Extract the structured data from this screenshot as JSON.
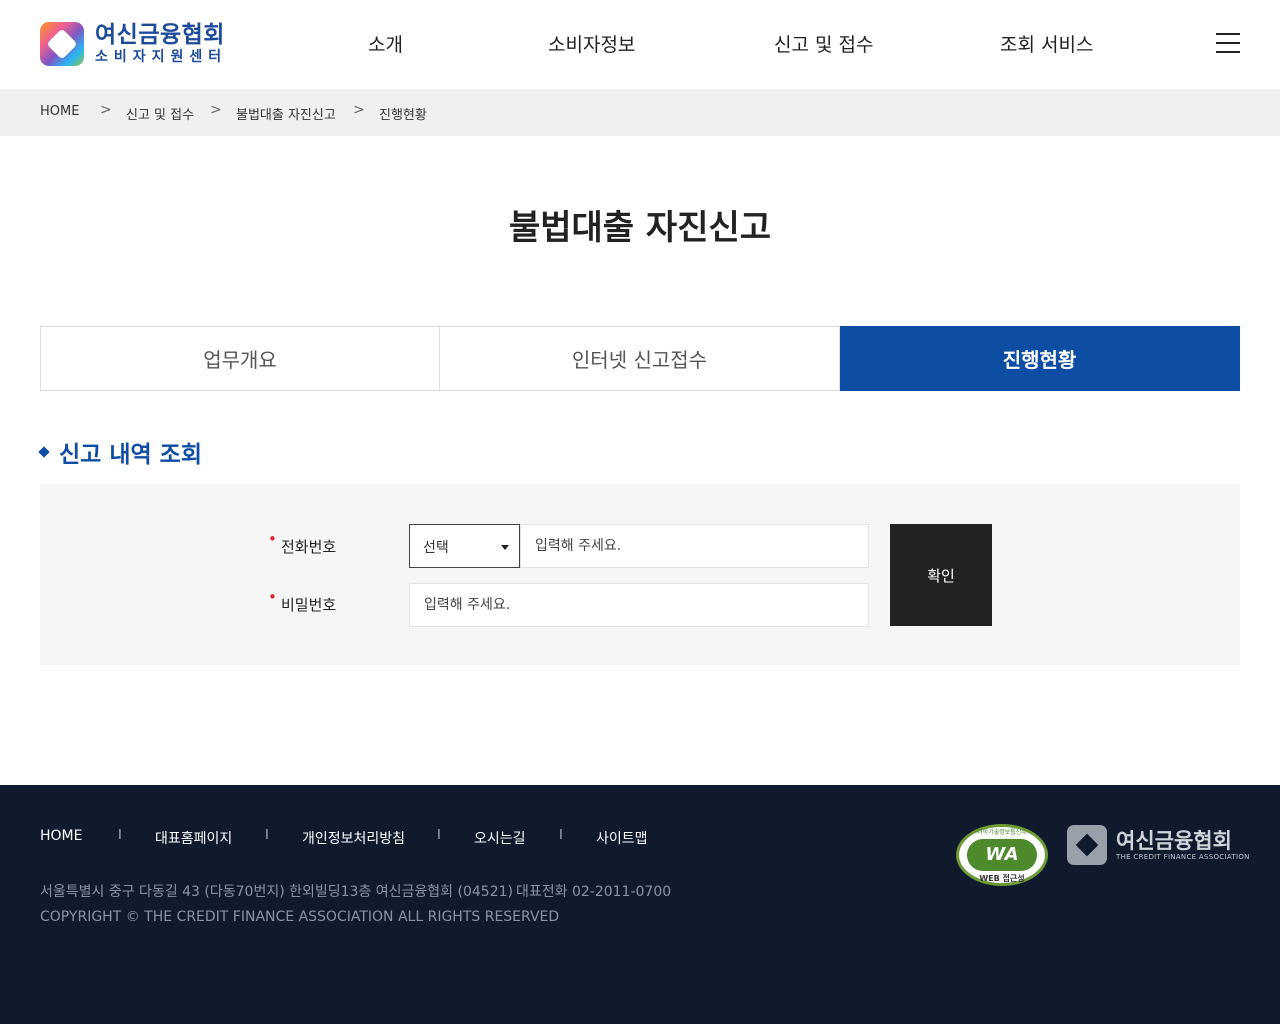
{
  "header": {
    "logo_main": "여신금융협회",
    "logo_sub": "소비자지원센터",
    "nav": [
      "소개",
      "소비자정보",
      "신고 및 접수",
      "조회 서비스"
    ]
  },
  "breadcrumb": [
    "HOME",
    "신고 및 접수",
    "불법대출 자진신고",
    "진행현황"
  ],
  "breadcrumb_sep": ">",
  "page_title": "불법대출 자진신고",
  "tabs": [
    {
      "label": "업무개요",
      "active": false
    },
    {
      "label": "인터넷 신고접수",
      "active": false
    },
    {
      "label": "진행현황",
      "active": true
    }
  ],
  "section_title": "신고 내역 조회",
  "form": {
    "required_mark": "•",
    "phone_label": "전화번호",
    "phone_select_value": "선택",
    "phone_placeholder": "입력해 주세요.",
    "password_label": "비밀번호",
    "password_placeholder": "입력해 주세요.",
    "confirm_label": "확인"
  },
  "footer": {
    "links": [
      "HOME",
      "대표홈페이지",
      "개인정보처리방침",
      "오시는길",
      "사이트맵"
    ],
    "link_sep": "I",
    "address": "서울특별시 중구 다동길 43 (다동70번지) 한외빌딩13층 여신금융협회 (04521)",
    "tel": "대표전화 02-2011-0700",
    "copyright": "COPYRIGHT © THE CREDIT FINANCE ASSOCIATION ALL RIGHTS RESERVED",
    "wa_mark": "WA",
    "wa_top": "과학기술정보통신부",
    "wa_bottom": "WEB 접근성",
    "logo_main": "여신금융협회",
    "logo_sub": "THE CREDIT FINANCE ASSOCIATION"
  },
  "colors": {
    "brand_blue": "#0d4ea4",
    "footer_bg": "#0f1b2d",
    "required_red": "#d8262f",
    "button_dark": "#222222"
  }
}
